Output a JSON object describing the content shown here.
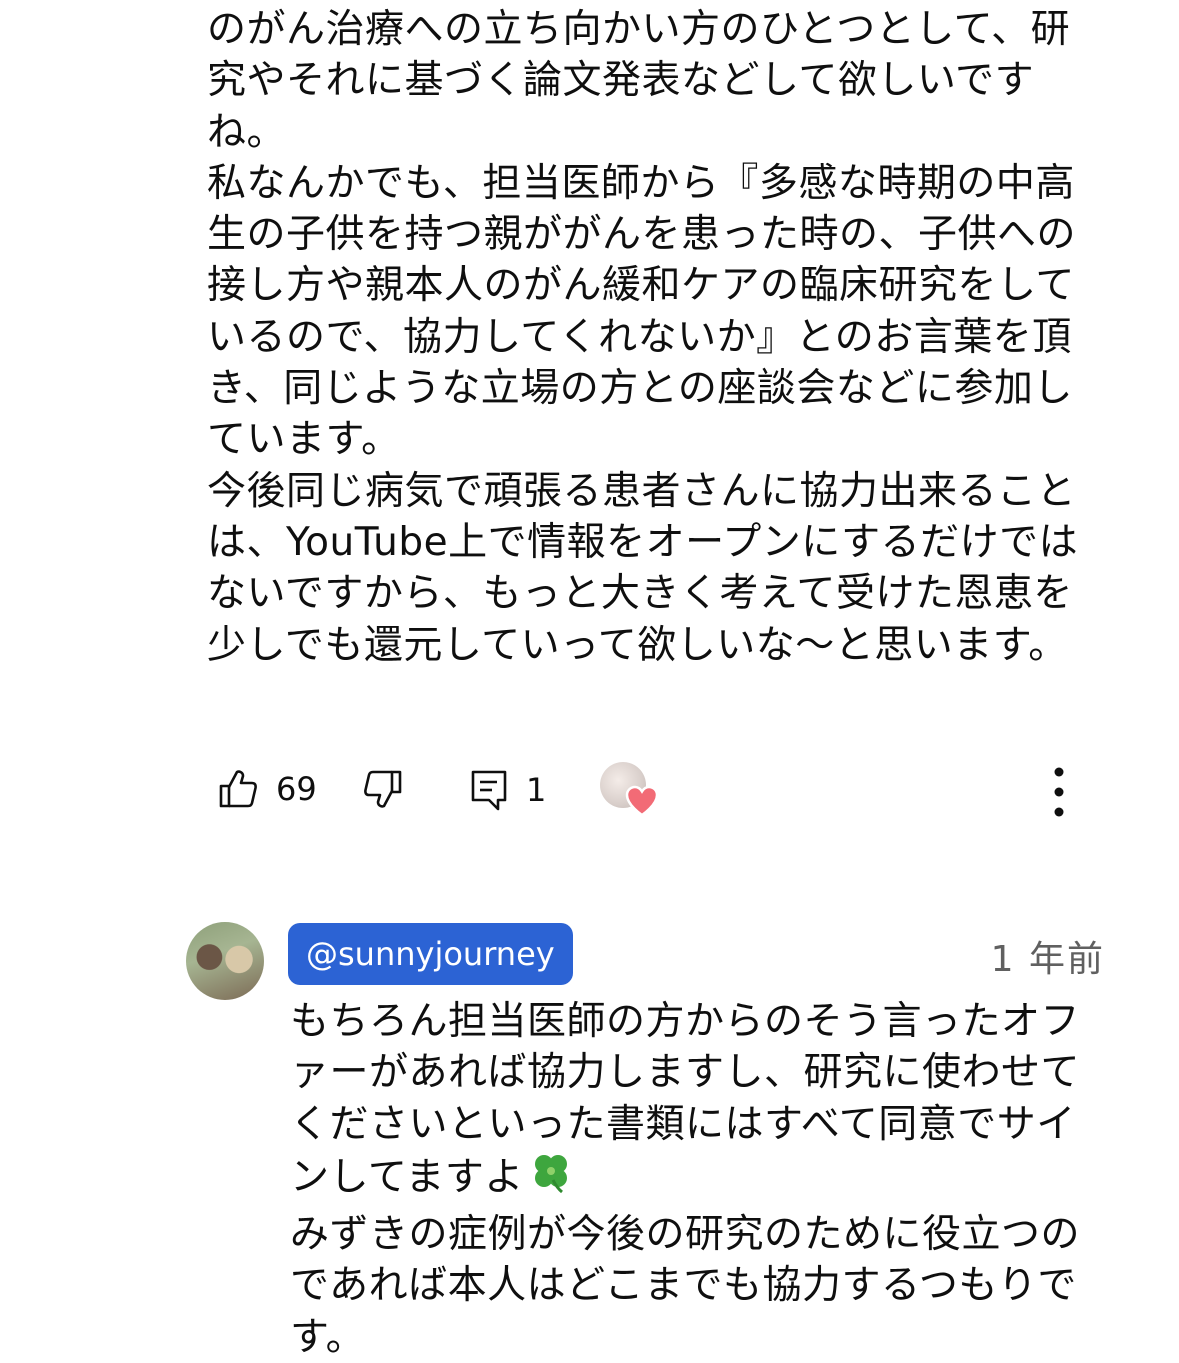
{
  "comment": {
    "paragraphs": [
      "のがん治療への立ち向かい方のひとつとして、研究やそれに基づく論文発表などして欲しいですね。",
      "私なんかでも、担当医師から『多感な時期の中高生の子供を持つ親ががんを患った時の、子供への接し方や親本人のがん緩和ケアの臨床研究をしているので、協力してくれないか』とのお言葉を頂き、同じような立場の方との座談会などに参加しています。",
      "今後同じ病気で頑張る患者さんに協力出来ることは、YouTube上で情報をオープンにするだけではないですから、もっと大きく考えて受けた恩恵を少しでも還元していって欲しいな〜と思います。"
    ]
  },
  "actions": {
    "like_count": "69",
    "reply_count": "1",
    "icons": {
      "like": "thumbs-up-icon",
      "dislike": "thumbs-down-icon",
      "reply": "comment-icon",
      "creator_heart": "heart-icon",
      "more": "more-vertical-icon"
    },
    "heart_color": "#f26b76"
  },
  "reply": {
    "author": "@sunnyjourney",
    "timestamp": "1 年前",
    "paragraphs": [
      "もちろん担当医師の方からのそう言ったオファーがあれば協力しますし、研究に使わせてくださいといった書類にはすべて同意でサインしてますよ",
      "みずきの症例が今後の研究のために役立つのであれば本人はどこまでも協力するつもりです。"
    ],
    "emoji": "four-leaf-clover-icon",
    "author_chip_color": "#2c63d4"
  }
}
